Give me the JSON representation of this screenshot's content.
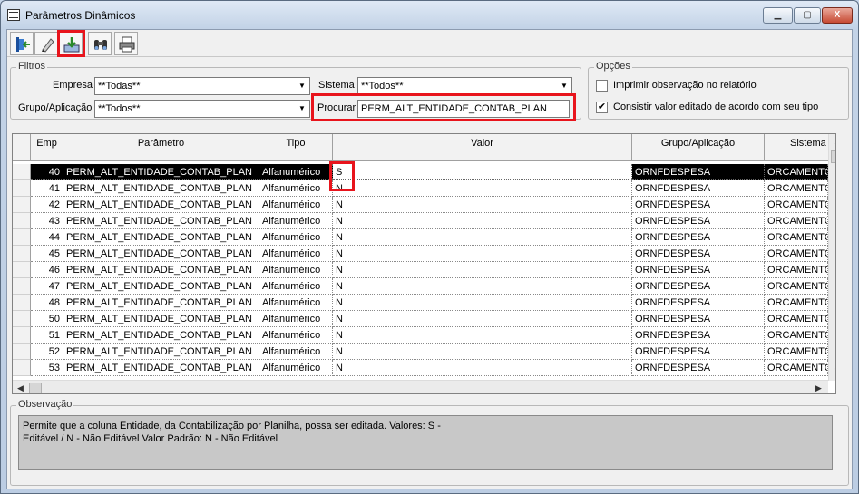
{
  "window": {
    "title": "Parâmetros Dinâmicos",
    "minimize": "▁",
    "maximize": "▢",
    "close": "X"
  },
  "toolbar": {
    "buttons": [
      {
        "name": "exit-icon"
      },
      {
        "name": "edit-eraser-icon"
      },
      {
        "name": "import-download-icon"
      },
      {
        "name": "binoculars-search-icon"
      },
      {
        "name": "printer-icon"
      }
    ]
  },
  "filtros": {
    "legend": "Filtros",
    "empresa_label": "Empresa",
    "empresa_value": "**Todas**",
    "sistema_label": "Sistema",
    "sistema_value": "**Todos**",
    "grupo_label": "Grupo/Aplicação",
    "grupo_value": "**Todos**",
    "procurar_label": "Procurar",
    "procurar_value": "PERM_ALT_ENTIDADE_CONTAB_PLAN"
  },
  "opcoes": {
    "legend": "Opções",
    "imprimir_label": "Imprimir observação no relatório",
    "imprimir_checked": false,
    "consistir_label": "Consistir valor editado de acordo com seu tipo",
    "consistir_checked": true
  },
  "grid": {
    "columns": [
      "Emp",
      "Parâmetro",
      "Tipo",
      "Valor",
      "Grupo/Aplicação",
      "Sistema"
    ],
    "rows": [
      {
        "emp": "40",
        "parametro": "PERM_ALT_ENTIDADE_CONTAB_PLAN",
        "tipo": "Alfanumérico",
        "valor": "S",
        "grupo": "ORNFDESPESA",
        "sistema": "ORCAMENTO"
      },
      {
        "emp": "41",
        "parametro": "PERM_ALT_ENTIDADE_CONTAB_PLAN",
        "tipo": "Alfanumérico",
        "valor": "N",
        "grupo": "ORNFDESPESA",
        "sistema": "ORCAMENTO"
      },
      {
        "emp": "42",
        "parametro": "PERM_ALT_ENTIDADE_CONTAB_PLAN",
        "tipo": "Alfanumérico",
        "valor": "N",
        "grupo": "ORNFDESPESA",
        "sistema": "ORCAMENTO"
      },
      {
        "emp": "43",
        "parametro": "PERM_ALT_ENTIDADE_CONTAB_PLAN",
        "tipo": "Alfanumérico",
        "valor": "N",
        "grupo": "ORNFDESPESA",
        "sistema": "ORCAMENTO"
      },
      {
        "emp": "44",
        "parametro": "PERM_ALT_ENTIDADE_CONTAB_PLAN",
        "tipo": "Alfanumérico",
        "valor": "N",
        "grupo": "ORNFDESPESA",
        "sistema": "ORCAMENTO"
      },
      {
        "emp": "45",
        "parametro": "PERM_ALT_ENTIDADE_CONTAB_PLAN",
        "tipo": "Alfanumérico",
        "valor": "N",
        "grupo": "ORNFDESPESA",
        "sistema": "ORCAMENTO"
      },
      {
        "emp": "46",
        "parametro": "PERM_ALT_ENTIDADE_CONTAB_PLAN",
        "tipo": "Alfanumérico",
        "valor": "N",
        "grupo": "ORNFDESPESA",
        "sistema": "ORCAMENTO"
      },
      {
        "emp": "47",
        "parametro": "PERM_ALT_ENTIDADE_CONTAB_PLAN",
        "tipo": "Alfanumérico",
        "valor": "N",
        "grupo": "ORNFDESPESA",
        "sistema": "ORCAMENTO"
      },
      {
        "emp": "48",
        "parametro": "PERM_ALT_ENTIDADE_CONTAB_PLAN",
        "tipo": "Alfanumérico",
        "valor": "N",
        "grupo": "ORNFDESPESA",
        "sistema": "ORCAMENTO"
      },
      {
        "emp": "50",
        "parametro": "PERM_ALT_ENTIDADE_CONTAB_PLAN",
        "tipo": "Alfanumérico",
        "valor": "N",
        "grupo": "ORNFDESPESA",
        "sistema": "ORCAMENTO"
      },
      {
        "emp": "51",
        "parametro": "PERM_ALT_ENTIDADE_CONTAB_PLAN",
        "tipo": "Alfanumérico",
        "valor": "N",
        "grupo": "ORNFDESPESA",
        "sistema": "ORCAMENTO"
      },
      {
        "emp": "52",
        "parametro": "PERM_ALT_ENTIDADE_CONTAB_PLAN",
        "tipo": "Alfanumérico",
        "valor": "N",
        "grupo": "ORNFDESPESA",
        "sistema": "ORCAMENTO"
      },
      {
        "emp": "53",
        "parametro": "PERM_ALT_ENTIDADE_CONTAB_PLAN",
        "tipo": "Alfanumérico",
        "valor": "N",
        "grupo": "ORNFDESPESA",
        "sistema": "ORCAMENTO"
      }
    ],
    "selected_row": 0
  },
  "observacao": {
    "legend": "Observação",
    "text_line1": "Permite que a coluna Entidade, da Contabilização por Planilha, possa ser editada. Valores: S -",
    "text_line2": "Editável / N - Não Editável Valor Padrão: N - Não Editável"
  },
  "colors": {
    "highlight": "#e8141c",
    "selection_bg": "#000000"
  }
}
